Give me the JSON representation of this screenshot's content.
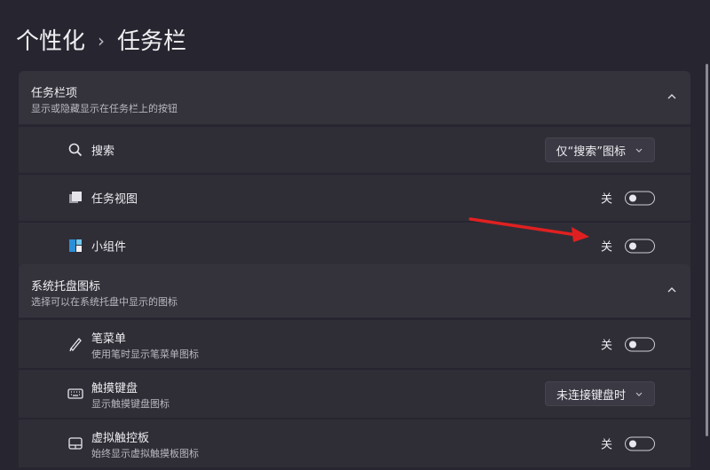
{
  "breadcrumb": {
    "parent": "个性化",
    "separator": "›",
    "current": "任务栏"
  },
  "sections": [
    {
      "title": "任务栏项",
      "subtitle": "显示或隐藏显示在任务栏上的按钮",
      "rows": [
        {
          "label": "搜索",
          "icon": "search-icon",
          "control": "dropdown",
          "value": "仅“搜索”图标"
        },
        {
          "label": "任务视图",
          "icon": "task-view-icon",
          "control": "toggle",
          "state": "关"
        },
        {
          "label": "小组件",
          "icon": "widgets-icon",
          "control": "toggle",
          "state": "关"
        }
      ]
    },
    {
      "title": "系统托盘图标",
      "subtitle": "选择可以在系统托盘中显示的图标",
      "rows": [
        {
          "label": "笔菜单",
          "sub": "使用笔时显示笔菜单图标",
          "icon": "pen-icon",
          "control": "toggle",
          "state": "关"
        },
        {
          "label": "触摸键盘",
          "sub": "显示触摸键盘图标",
          "icon": "keyboard-icon",
          "control": "dropdown",
          "value": "未连接键盘时"
        },
        {
          "label": "虚拟触控板",
          "sub": "始终显示虚拟触摸板图标",
          "icon": "touchpad-icon",
          "control": "toggle",
          "state": "关"
        }
      ]
    }
  ],
  "colors": {
    "background": "#272630",
    "card": "#2f2e37",
    "header": "#34333c",
    "annotation_arrow": "#e02020"
  }
}
